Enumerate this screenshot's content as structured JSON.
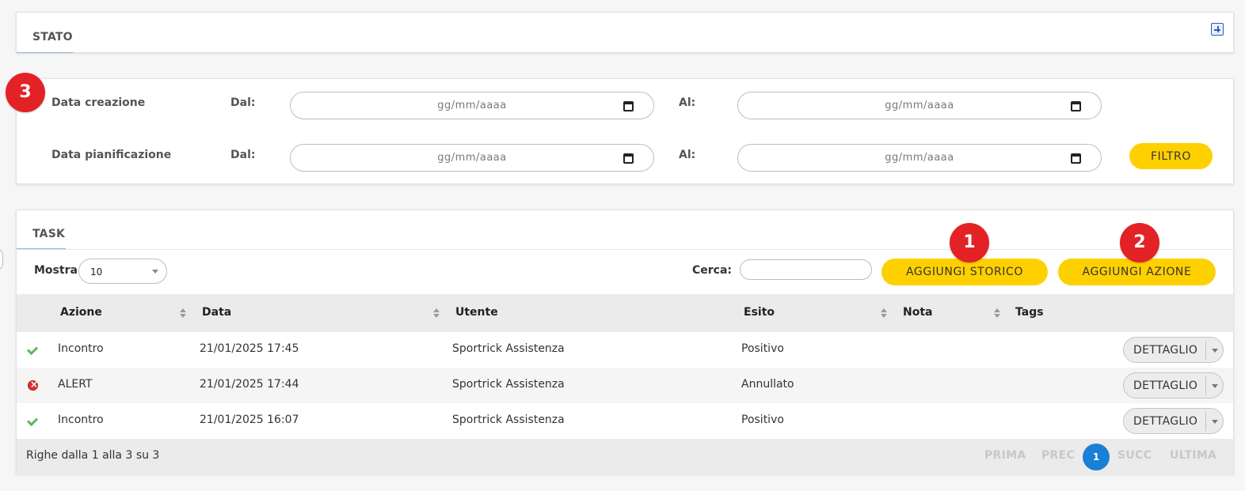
{
  "stato": {
    "title": "STATO"
  },
  "filter": {
    "rows": [
      {
        "label": "Data creazione",
        "dal_label": "Dal:",
        "dal_placeholder": "gg/mm/aaaa",
        "al_label": "Al:",
        "al_placeholder": "gg/mm/aaaa"
      },
      {
        "label": "Data pianificazione",
        "dal_label": "Dal:",
        "dal_placeholder": "gg/mm/aaaa",
        "al_label": "Al:",
        "al_placeholder": "gg/mm/aaaa"
      }
    ],
    "filter_button": "FILTRO"
  },
  "task": {
    "title": "TASK",
    "mostra_label": "Mostra",
    "mostra_value": "10",
    "cerca_label": "Cerca:",
    "cerca_value": "",
    "add_storico": "AGGIUNGI STORICO",
    "add_azione": "AGGIUNGI AZIONE",
    "columns": [
      "Azione",
      "Data",
      "Utente",
      "Esito",
      "Nota",
      "Tags"
    ],
    "rows": [
      {
        "status": "check-icon",
        "azione": "Incontro",
        "data": "21/01/2025 17:45",
        "utente": "Sportrick Assistenza",
        "esito": "Positivo",
        "nota": "",
        "tags": "",
        "action": "DETTAGLIO"
      },
      {
        "status": "x-icon",
        "azione": "ALERT",
        "data": "21/01/2025 17:44",
        "utente": "Sportrick Assistenza",
        "esito": "Annullato",
        "nota": "",
        "tags": "",
        "action": "DETTAGLIO"
      },
      {
        "status": "check-icon",
        "azione": "Incontro",
        "data": "21/01/2025 16:07",
        "utente": "Sportrick Assistenza",
        "esito": "Positivo",
        "nota": "",
        "tags": "",
        "action": "DETTAGLIO"
      }
    ],
    "footer_text": "Righe dalla 1 alla 3 su 3",
    "pagination": {
      "first": "PRIMA",
      "prev": "PREC",
      "current": "1",
      "next": "SUCC",
      "last": "ULTIMA"
    }
  },
  "badges": [
    "1",
    "2",
    "3"
  ],
  "colors": {
    "accent_yellow": "#ffd000",
    "badge_red": "#e32226",
    "page_blue": "#1a7fd6",
    "check_green": "#5cb85c"
  }
}
